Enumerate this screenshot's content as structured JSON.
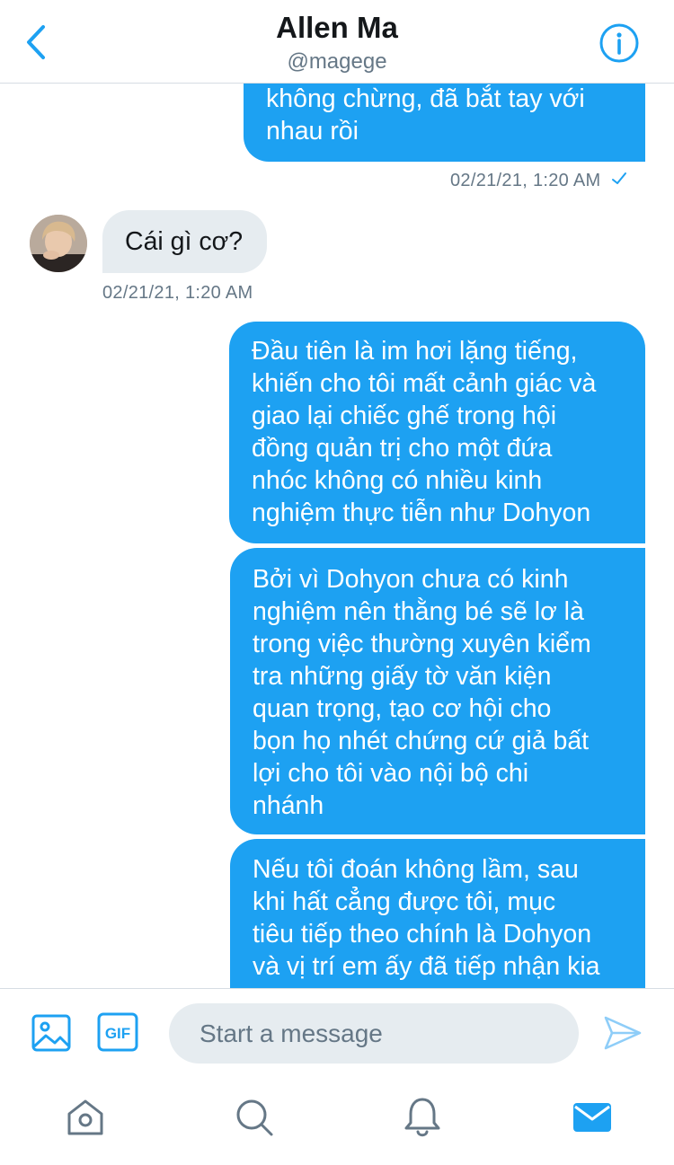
{
  "header": {
    "title": "Allen Ma",
    "handle": "@magege"
  },
  "messages": [
    {
      "direction": "outgoing",
      "text": "không chừng, đã bắt tay với\nnhau rồi"
    },
    {
      "direction": "outgoing_timestamp",
      "text": "02/21/21, 1:20 AM"
    },
    {
      "direction": "incoming",
      "text": "Cái gì cơ?"
    },
    {
      "direction": "incoming_timestamp",
      "text": "02/21/21, 1:20 AM"
    },
    {
      "direction": "outgoing",
      "text": "Đầu tiên là im hơi lặng tiếng,\nkhiến cho tôi mất cảnh giác và\ngiao lại chiếc ghế trong hội\nđồng quản trị cho một đứa\nnhóc không có nhiều kinh\nnghiệm thực tiễn như Dohyon"
    },
    {
      "direction": "outgoing",
      "text": "Bởi vì Dohyon chưa có kinh\nnghiệm nên thằng bé sẽ lơ là\ntrong việc thường xuyên kiểm\ntra những giấy tờ văn kiện\nquan trọng, tạo cơ hội cho\nbọn họ nhét chứng cứ giả bất\nlợi cho tôi vào nội bộ chi\nnhánh"
    },
    {
      "direction": "outgoing",
      "text": "Nếu tôi đoán không lầm, sau\nkhi hất cẳng được tôi, mục\ntiêu tiếp theo chính là Dohyon\nvà vị trí em ấy đã tiếp nhận kia"
    }
  ],
  "composer": {
    "placeholder": "Start a message",
    "gif_label": "GIF"
  },
  "icons": {
    "back": "chevron-left-icon",
    "info": "info-icon",
    "media": "image-icon",
    "gif": "gif-icon",
    "send": "send-icon",
    "read": "checkmark-icon",
    "home": "home-icon",
    "search": "search-icon",
    "notifications": "bell-icon",
    "messages": "mail-icon"
  },
  "colors": {
    "accent": "#1da1f2",
    "incoming_bubble": "#e6ecf0",
    "secondary_text": "#657786"
  }
}
